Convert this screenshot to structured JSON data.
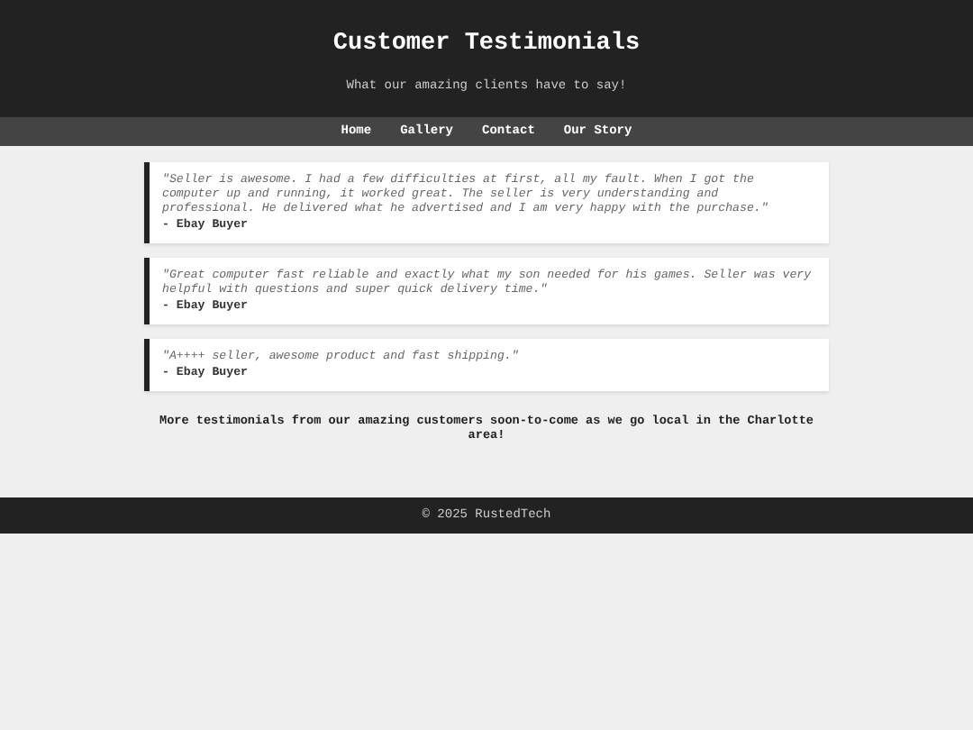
{
  "header": {
    "title": "Customer Testimonials",
    "subtitle": "What our amazing clients have to say!"
  },
  "nav": [
    "Home",
    "Gallery",
    "Contact",
    "Our Story"
  ],
  "testimonials": [
    {
      "quote": "\"Seller is awesome. I had a few difficulties at first, all my fault. When I got the computer up and running, it worked great. The seller is very understanding and professional. He delivered what he advertised and I am very happy with the purchase.\"",
      "author": "- Ebay Buyer"
    },
    {
      "quote": "\"Great computer fast reliable and exactly what my son needed for his games. Seller was very helpful with questions and super quick delivery time.\"",
      "author": "- Ebay Buyer"
    },
    {
      "quote": "\"A++++ seller, awesome product and fast shipping.\"",
      "author": "- Ebay Buyer"
    }
  ],
  "note": "More testimonials from our amazing customers soon-to-come as we go local in the Charlotte area!",
  "footer": "© 2025 RustedTech"
}
